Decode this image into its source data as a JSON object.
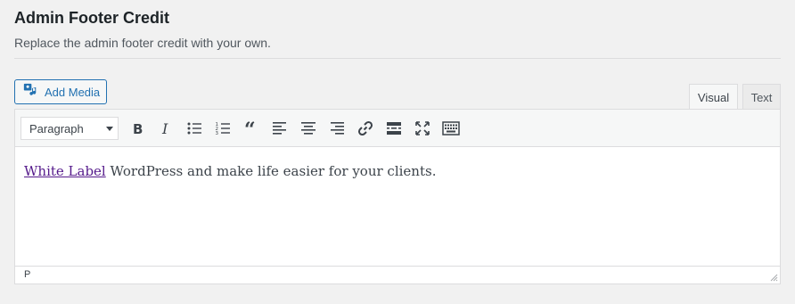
{
  "section": {
    "title": "Admin Footer Credit",
    "description": "Replace the admin footer credit with your own."
  },
  "media": {
    "add_label": "Add Media"
  },
  "tabs": {
    "visual": "Visual",
    "text": "Text",
    "active": "Visual"
  },
  "toolbar": {
    "format_value": "Paragraph",
    "buttons": [
      "bold-icon",
      "italic-icon",
      "bulleted-list-icon",
      "numbered-list-icon",
      "blockquote-icon",
      "align-left-icon",
      "align-center-icon",
      "align-right-icon",
      "insert-link-icon",
      "read-more-icon",
      "fullscreen-icon",
      "toolbar-toggle-icon"
    ]
  },
  "content": {
    "link_text": "White Label",
    "body_text": " WordPress and make life easier for your clients."
  },
  "status": {
    "path": "P"
  },
  "colors": {
    "accent": "#2271b1",
    "link_visited": "#551a8b",
    "border": "#dcdcde"
  }
}
